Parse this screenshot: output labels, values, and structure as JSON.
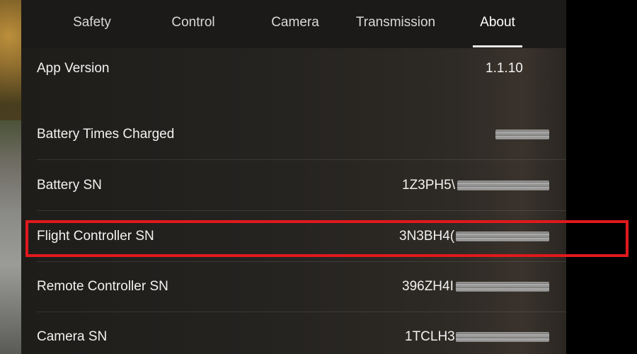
{
  "tabs": [
    {
      "label": "Safety"
    },
    {
      "label": "Control"
    },
    {
      "label": "Camera"
    },
    {
      "label": "Transmission"
    },
    {
      "label": "About"
    }
  ],
  "active_tab": "About",
  "rows": {
    "app_version": {
      "label": "App Version",
      "value": "1.1.10"
    },
    "battery_times_charged": {
      "label": "Battery Times Charged",
      "value": ""
    },
    "battery_sn": {
      "label": "Battery SN",
      "value": "1Z3PH5\\"
    },
    "flight_controller_sn": {
      "label": "Flight Controller SN",
      "value": "3N3BH4("
    },
    "remote_controller_sn": {
      "label": "Remote Controller SN",
      "value": "396ZH4I"
    },
    "camera_sn": {
      "label": "Camera SN",
      "value": "1TCLH3"
    }
  },
  "colors": {
    "highlight": "#e0191d",
    "panel": "#262421",
    "text": "#f2f2f2"
  }
}
